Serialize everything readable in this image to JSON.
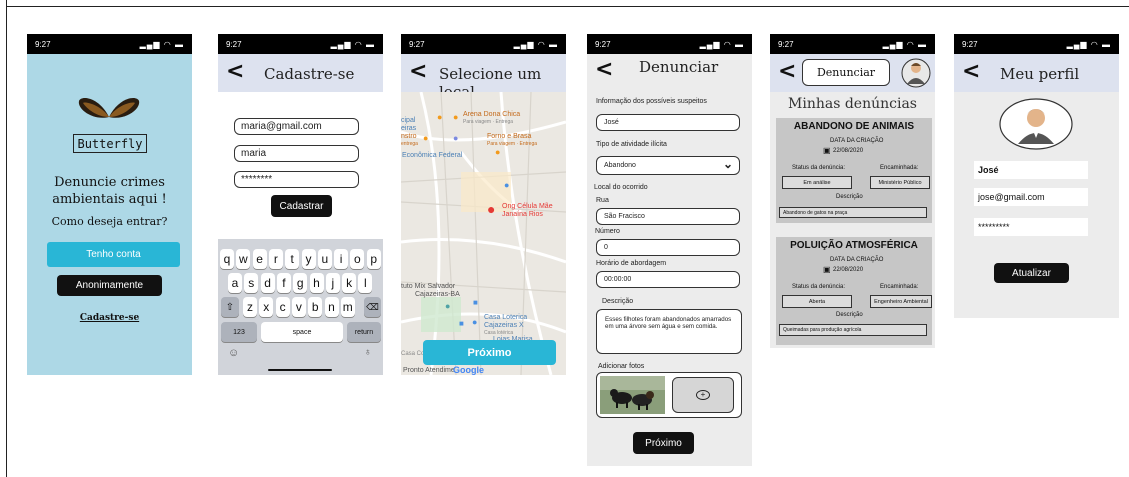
{
  "status_time": "9:27",
  "screen1": {
    "logo_text": "Butterfly",
    "headline": "Denuncie crimes ambientais aqui !",
    "question": "Como deseja entrar?",
    "btn_account": "Tenho conta",
    "btn_anon": "Anonimamente",
    "link_signup": "Cadastre-se"
  },
  "screen2": {
    "title": "Cadastre-se",
    "email": "maria@gmail.com",
    "name": "maria",
    "password": "********",
    "btn_submit": "Cadastrar",
    "keys_row1": [
      "q",
      "w",
      "e",
      "r",
      "t",
      "y",
      "u",
      "i",
      "o",
      "p"
    ],
    "keys_row2": [
      "a",
      "s",
      "d",
      "f",
      "g",
      "h",
      "j",
      "k",
      "l"
    ],
    "keys_row3": [
      "z",
      "x",
      "c",
      "v",
      "b",
      "n",
      "m"
    ],
    "key_numbers": "123",
    "key_space": "space",
    "key_return": "return"
  },
  "screen3": {
    "title": "Selecione um local",
    "places": {
      "arena": "Arena Dona Chica",
      "arena_sub": "Para viagem · Entrega",
      "forno": "Forno e Brasa",
      "forno_sub": "Para viagem · Entrega",
      "cipal": "cipal",
      "eiras": "eiras",
      "nstro": "nstro",
      "entrega": "entrega",
      "economica": "Econômica Federal",
      "ong": "Ong Célula Mãe Janaína Rios",
      "tuto": "tuto Mix Salvador",
      "cajazeiras": "Cajazeiras-BA",
      "loterica": "Casa Loterica Cajazeiras X",
      "loterica_sub": "Casa lotérica",
      "lojas": "Lojas Marisa",
      "pronto": "Pronto Atendime",
      "google": "Google",
      "casa_cor": "Casa Cor"
    },
    "btn_next": "Próximo"
  },
  "screen4": {
    "title": "Denunciar",
    "info_label": "Informação dos possíveis suspeitos",
    "info_value": "José",
    "type_label": "Tipo de atividade ilícita",
    "type_value": "Abandono",
    "local_label": "Local  do ocorrido",
    "street_label": "Rua",
    "street_value": "São Fracisco",
    "number_label": "Número",
    "number_value": "0",
    "time_label": "Horário  de abordagem",
    "time_value": "00:00:00",
    "desc_label": "Descrição",
    "desc_value": "Esses filhotes foram abandonados amarrados em uma árvore sem água e sem comida.",
    "photos_label": "Adicionar fotos",
    "btn_next": "Próximo"
  },
  "screen5": {
    "tab_label": "Denunciar",
    "heading": "Minhas denúncias",
    "cards": [
      {
        "title": "ABANDONO DE ANIMAIS",
        "date_label": "DATA DA CRIAÇÃO",
        "date": "22/08/2020",
        "status_label": "Status da denúncia:",
        "forward_label": "Encaminhada:",
        "status": "Em análise",
        "forward": "Ministério Público",
        "desc_label": "Descrição",
        "desc": "Abandono de gatos na praça"
      },
      {
        "title": "POLUIÇÃO ATMOSFÉRICA",
        "date_label": "DATA DA CRIAÇÃO",
        "date": "22/08/2020",
        "status_label": "Status da denúncia:",
        "forward_label": "Encaminhada:",
        "status": "Aberta",
        "forward": "Engenheiro Ambiental",
        "desc_label": "Descrição",
        "desc": "Queimadas para produção agrícola"
      }
    ]
  },
  "screen6": {
    "title": "Meu perfil",
    "name": "José",
    "email": "jose@gmail.com",
    "password": "*********",
    "btn_update": "Atualizar"
  }
}
